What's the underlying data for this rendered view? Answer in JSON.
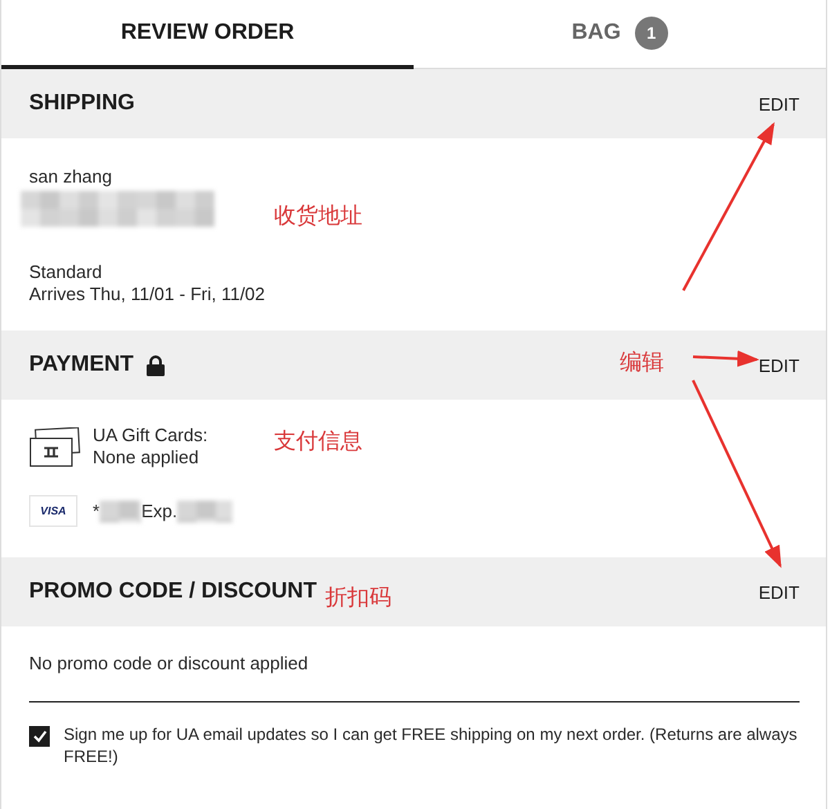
{
  "tabs": [
    {
      "label": "REVIEW ORDER",
      "selected": true
    },
    {
      "label": "BAG",
      "selected": false,
      "badge": "1"
    }
  ],
  "shipping": {
    "title": "SHIPPING",
    "action": "EDIT",
    "name": "san zhang",
    "method": "Standard",
    "arrival": "Arrives Thu, 11/01 - Fri, 11/02"
  },
  "payment": {
    "title": "PAYMENT",
    "locked": true,
    "action": "EDIT",
    "gift_card": {
      "label": "UA Gift Cards:",
      "status": "None applied"
    },
    "card": {
      "brand": "VISA",
      "prefix": "*",
      "expiry_label": "Exp."
    }
  },
  "promo": {
    "title": "PROMO CODE / DISCOUNT",
    "action": "EDIT",
    "status": "No promo code or discount applied"
  },
  "newsletter": {
    "checked": true,
    "text": "Sign me up for UA email updates so I can get FREE shipping on my next order. (Returns are always FREE!)"
  },
  "annotations": [
    {
      "text": "收货地址"
    },
    {
      "text": "编辑"
    },
    {
      "text": "支付信息"
    },
    {
      "text": "折扣码"
    }
  ]
}
